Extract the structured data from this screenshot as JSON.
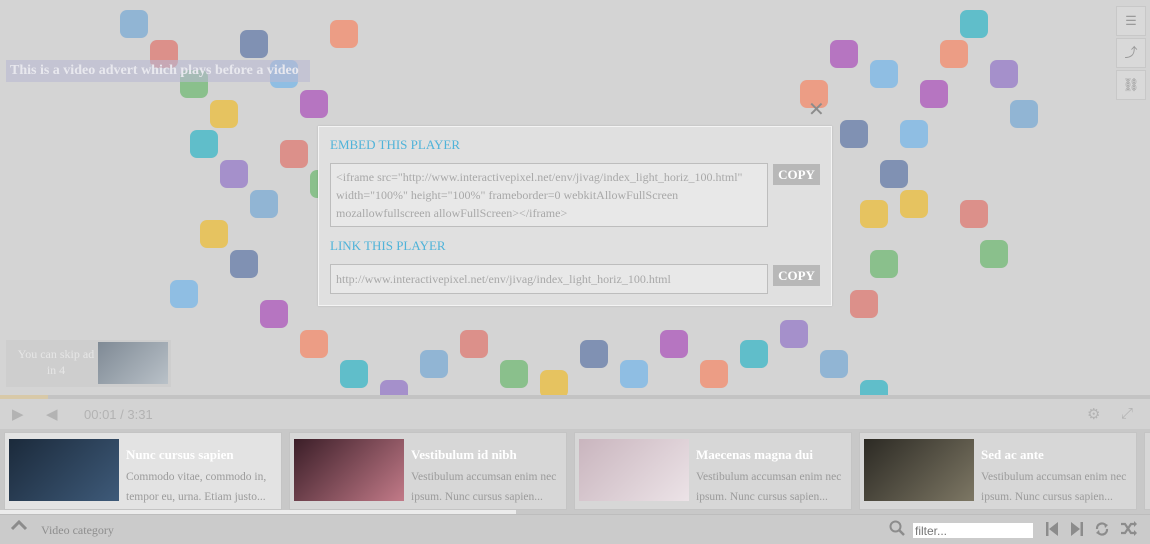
{
  "ad_text": "This is a video advert which plays before a video",
  "skip_text": "You can skip ad in 4",
  "time": "00:01 / 3:31",
  "playlist": [
    {
      "title": "Nunc cursus sapien",
      "desc": "Commodo vitae, commodo in, tempor eu, urna. Etiam justo...",
      "thumb": "#1b2a3b",
      "thumb2": "#3e5a79",
      "active": true
    },
    {
      "title": "Vestibulum id nibh",
      "desc": "Vestibulum accumsan enim nec ipsum. Nunc cursus sapien...",
      "thumb": "#3b1e28",
      "thumb2": "#c27a88",
      "active": false
    },
    {
      "title": "Maecenas magna dui",
      "desc": "Vestibulum accumsan enim nec ipsum. Nunc cursus sapien...",
      "thumb": "#c9b5be",
      "thumb2": "#ece3e7",
      "active": false
    },
    {
      "title": "Sed ac ante",
      "desc": "Vestibulum accumsan enim nec ipsum. Nunc cursus sapien...",
      "thumb": "#2c2a24",
      "thumb2": "#7d7764",
      "active": false
    }
  ],
  "bottom": {
    "category": "Video category",
    "filter_placeholder": "filter..."
  },
  "modal": {
    "embed_title": "EMBED THIS PLAYER",
    "embed_code": "<iframe src=\"http://www.interactivepixel.net/env/jivag/index_light_horiz_100.html\" width=\"100%\" height=\"100%\" frameborder=0 webkitAllowFullScreen mozallowfullscreen allowFullScreen></iframe>",
    "link_title": "LINK THIS PLAYER",
    "link_url": "http://www.interactivepixel.net/env/jivag/index_light_horiz_100.html",
    "copy_label": "COPY",
    "close_icon": "close-icon"
  },
  "colors": {
    "accent": "#4fb3d9",
    "copy_bg": "#b8b8b8"
  }
}
